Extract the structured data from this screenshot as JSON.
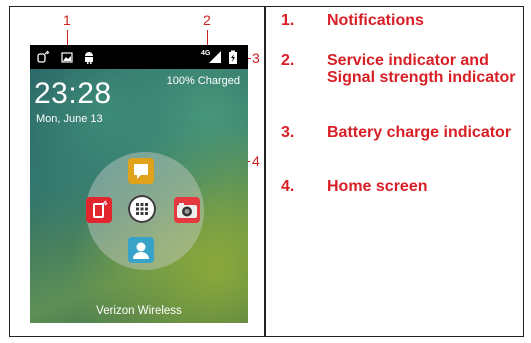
{
  "callouts": {
    "c1": "1",
    "c2": "2",
    "c3": "3",
    "c4": "4"
  },
  "phone": {
    "status_icons_left": [
      "usb-debug-icon",
      "image-icon",
      "android-icon"
    ],
    "status_icons_right": [
      "4g-signal-icon",
      "battery-charging-icon"
    ],
    "service_label": "4G",
    "charge_text": "100% Charged",
    "time": "23:28",
    "date": "Mon, June 13",
    "apps": [
      "messaging-app-icon",
      "phone-app-icon",
      "app-launcher-icon",
      "camera-app-icon",
      "contacts-app-icon"
    ],
    "carrier": "Verizon Wireless"
  },
  "legend": [
    {
      "num": "1.",
      "text": "Notifications"
    },
    {
      "num": "2.",
      "text": "Service indicator and Signal strength indicator"
    },
    {
      "num": "3.",
      "text": "Battery charge indicator"
    },
    {
      "num": "4.",
      "text": "Home screen"
    }
  ],
  "colors": {
    "accent": "#d81f26",
    "callout": "#cc1f1f",
    "status_bar": "#000000"
  }
}
